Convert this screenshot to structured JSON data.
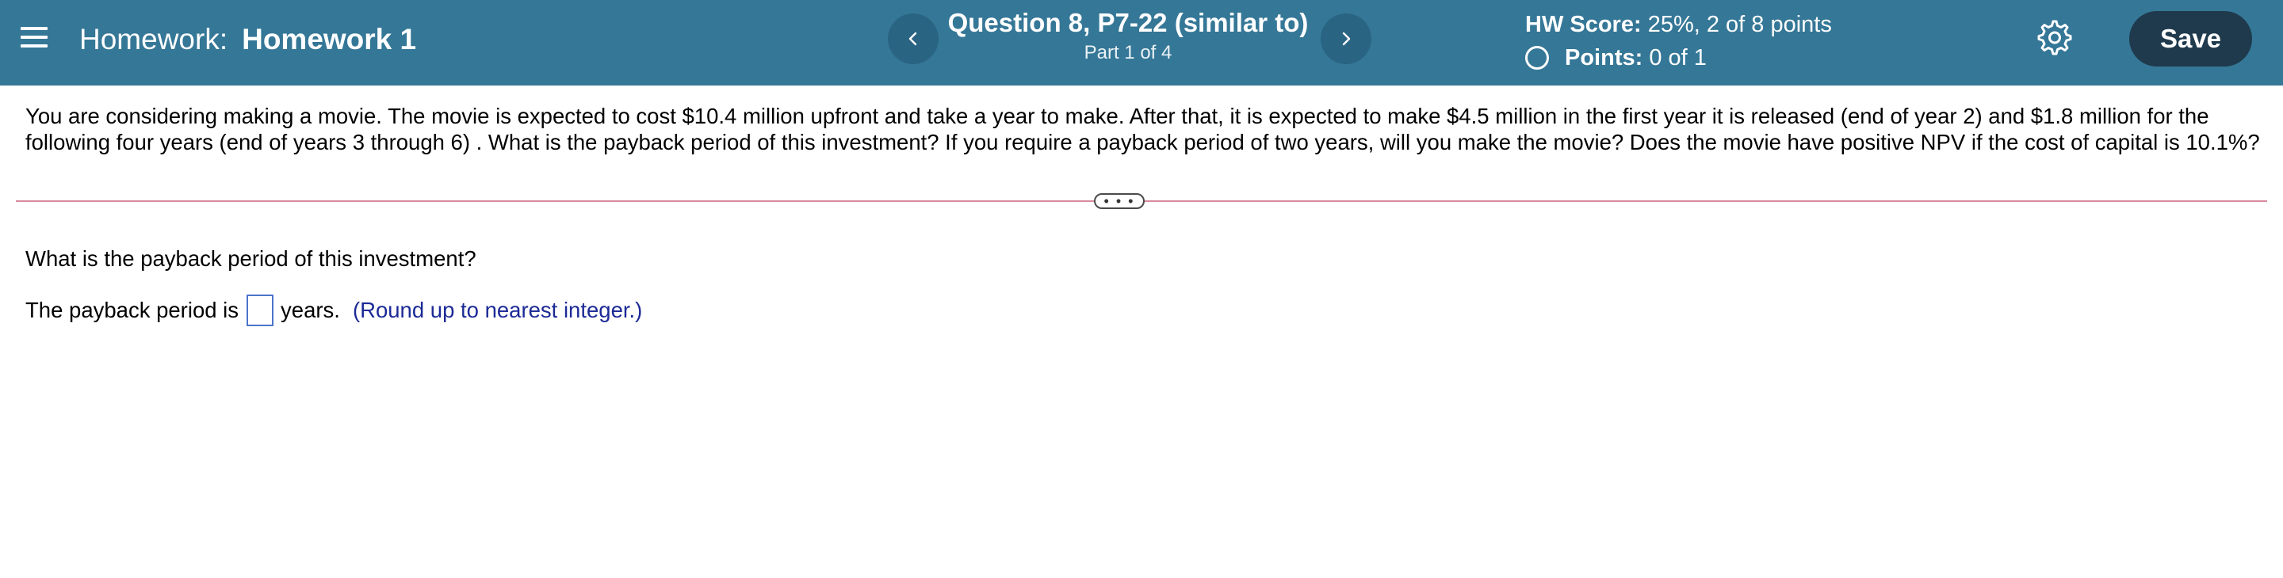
{
  "header": {
    "homework_label": "Homework:",
    "homework_name": "Homework 1",
    "question_title": "Question 8, P7-22 (similar to)",
    "part": "Part 1 of 4",
    "hw_score_label": "HW Score:",
    "hw_score_value": "25%, 2 of 8 points",
    "points_label": "Points:",
    "points_value": "0 of 1",
    "save_label": "Save",
    "icons": {
      "menu": "hamburger-menu-icon",
      "prev": "chevron-left-icon",
      "next": "chevron-right-icon",
      "status": "empty-circle-icon",
      "settings": "gear-icon"
    }
  },
  "problem": {
    "text": "You are considering making a movie. The movie is expected to cost $10.4 million upfront and take a year to make. After that, it is expected to make $4.5 million in the first year it is released (end of year 2) and $1.8 million for the following four years (end of years 3 through 6) . What is the payback period of this investment? If you require a payback period of two years, will you make the movie? Does the movie have positive NPV if the cost of capital is 10.1%?"
  },
  "question": {
    "prompt": "What is the payback period of this investment?",
    "answer_prefix": "The payback period is",
    "answer_value": "",
    "answer_suffix": "years.",
    "hint": "(Round up to nearest integer.)"
  },
  "expand_label": "• • •",
  "colors": {
    "header_bg": "#357797",
    "nav_button_bg": "#2a6483",
    "save_button_bg": "#1f3a4d",
    "divider": "#d98a9c",
    "hint_text": "#1c2a96",
    "input_border": "#4a74c9"
  }
}
